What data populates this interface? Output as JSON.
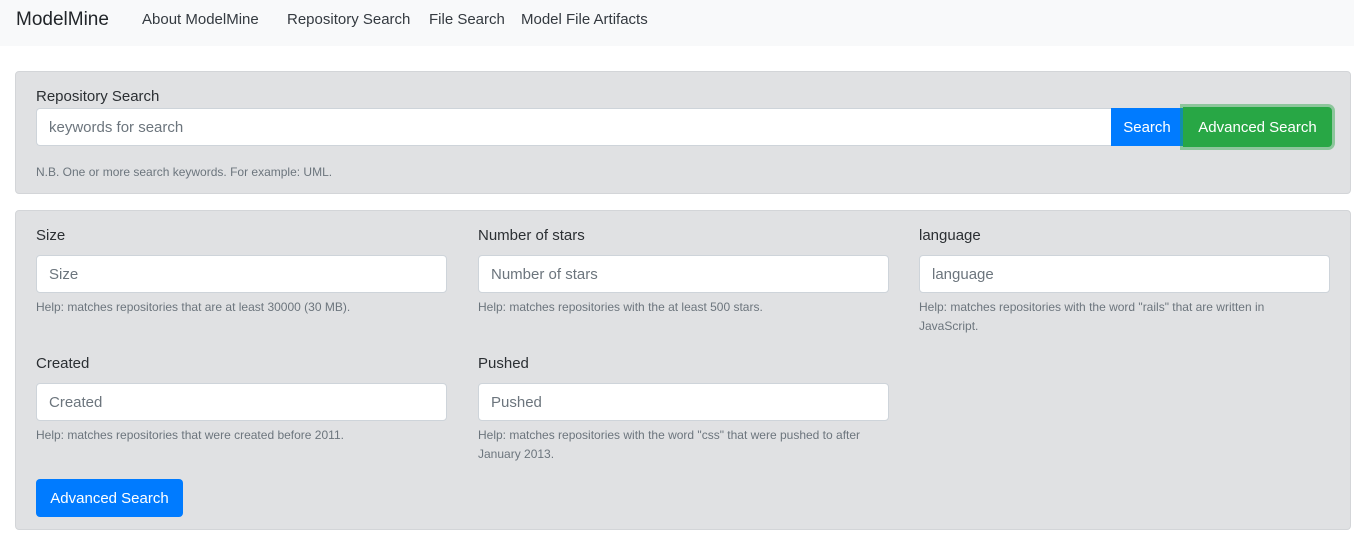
{
  "navbar": {
    "brand": "ModelMine",
    "links": [
      "About ModelMine",
      "Repository Search",
      "File Search",
      "Model File Artifacts"
    ]
  },
  "repo_search": {
    "label": "Repository Search",
    "placeholder": "keywords for search",
    "search_button": "Search",
    "advanced_button": "Advanced Search",
    "help": "N.B. One or more search keywords. For example: UML."
  },
  "advanced": {
    "fields": [
      {
        "label": "Size",
        "placeholder": "Size",
        "help": "Help: matches repositories that are at least 30000 (30 MB)."
      },
      {
        "label": "Number of stars",
        "placeholder": "Number of stars",
        "help": "Help: matches repositories with the at least 500 stars."
      },
      {
        "label": "language",
        "placeholder": "language",
        "help": "Help: matches repositories with the word \"rails\" that are written in JavaScript."
      },
      {
        "label": "Created",
        "placeholder": "Created",
        "help": "Help: matches repositories that were created before 2011."
      },
      {
        "label": "Pushed",
        "placeholder": "Pushed",
        "help": "Help: matches repositories with the word \"css\" that were pushed to after January 2013."
      }
    ],
    "submit_button": "Advanced Search"
  },
  "colors": {
    "primary": "#007bff",
    "success": "#28a745",
    "card_bg": "#e0e1e3",
    "navbar_bg": "#f8f9fa"
  }
}
